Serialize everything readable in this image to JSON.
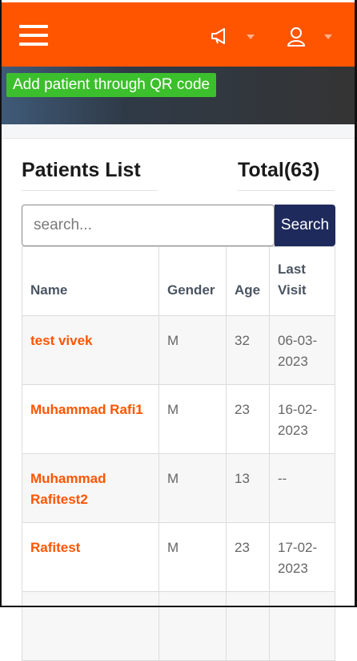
{
  "topbar": {
    "menu_icon": "hamburger-menu-icon",
    "announce_icon": "megaphone-icon",
    "user_icon": "user-icon",
    "background": "#ff5500"
  },
  "banner": {
    "qr_button_label": "Add patient through QR code",
    "qr_button_color": "#3cbf2c"
  },
  "patients": {
    "title": "Patients List",
    "total": "Total(63)",
    "search_placeholder": "search...",
    "search_button": "Search",
    "columns": [
      "Name",
      "Gender",
      "Age",
      "Last Visit"
    ],
    "rows": [
      {
        "name": "test vivek",
        "gender": "M",
        "age": "32",
        "last_visit": "06-03-2023"
      },
      {
        "name": "Muhammad Rafi1",
        "gender": "M",
        "age": "23",
        "last_visit": "16-02-2023"
      },
      {
        "name": "Muhammad Rafitest2",
        "gender": "M",
        "age": "13",
        "last_visit": "--"
      },
      {
        "name": "Rafitest",
        "gender": "M",
        "age": "23",
        "last_visit": "17-02-2023"
      },
      {
        "name": "",
        "gender": "",
        "age": "",
        "last_visit": ""
      }
    ],
    "name_color": "#ff5500",
    "search_button_color": "#1f2a5c"
  }
}
